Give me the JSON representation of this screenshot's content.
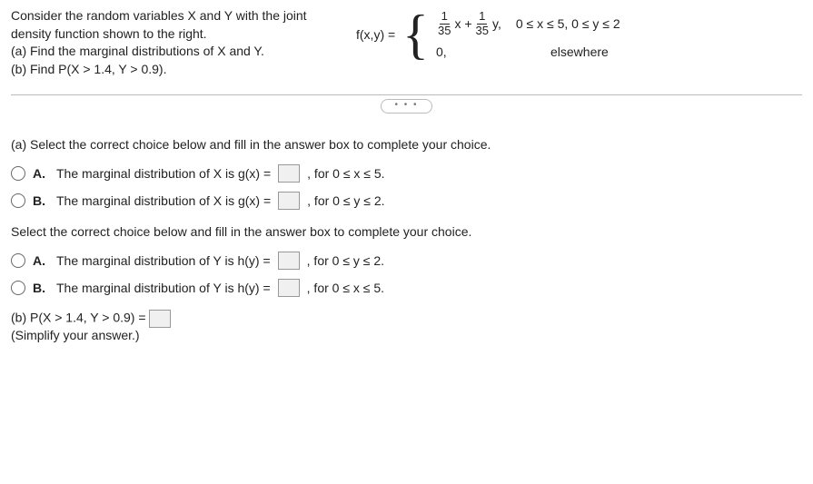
{
  "problem": {
    "intro": "Consider the random variables X and Y with the joint density function shown to the right.",
    "part_a": "(a) Find the marginal distributions of X and Y.",
    "part_b": "(b) Find P(X > 1.4, Y > 0.9)."
  },
  "equation": {
    "lhs": "f(x,y) =",
    "frac1_num": "1",
    "frac1_den": "35",
    "x": "x +",
    "frac2_num": "1",
    "frac2_den": "35",
    "y": "y,",
    "domain1": "0 ≤ x ≤ 5, 0 ≤ y ≤ 2",
    "zero": "0,",
    "elsewhere": "elsewhere"
  },
  "section_a": {
    "prompt": "(a) Select the correct choice below and fill in the answer box to complete your choice.",
    "A_label": "A.",
    "A_text1": "The marginal distribution of X is g(x) =",
    "A_text2": ", for 0 ≤ x ≤ 5.",
    "B_label": "B.",
    "B_text1": "The marginal distribution of X is g(x) =",
    "B_text2": ", for 0 ≤ y ≤ 2."
  },
  "section_y": {
    "prompt": "Select the correct choice below and fill in the answer box to complete your choice.",
    "A_label": "A.",
    "A_text1": "The marginal distribution of Y is h(y) =",
    "A_text2": ", for 0 ≤ y ≤ 2.",
    "B_label": "B.",
    "B_text1": "The marginal distribution of Y is h(y) =",
    "B_text2": ", for 0 ≤ x ≤ 5."
  },
  "section_b": {
    "text": "(b) P(X > 1.4, Y > 0.9) =",
    "simplify": "(Simplify your answer.)"
  },
  "dots": "• • •"
}
